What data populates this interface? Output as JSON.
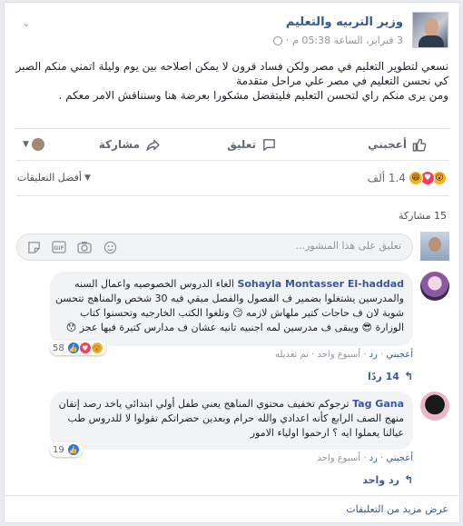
{
  "post": {
    "author": "وزير التربيه والتعليم",
    "timestamp": "3 فبراير، الساعة 05:38 م",
    "separator": "·",
    "privacy_icon": "globe-icon",
    "lines": [
      "نسعي لتطوير التعليم في مصر ولكن فساد قرون لا يمكن اصلاحه بين يوم وليلة اتمني منكم الصبر",
      "كي نحسن التعليم في مصر علي مراحل متقدمة",
      "ومن يرى منكم راي لتحسن التعليم فليتفضل مشكورا بعرضة هنا وسنناقش الامر معكم ."
    ]
  },
  "actions": {
    "like": "أعجبني",
    "comment": "تعليق",
    "share": "مشاركة"
  },
  "reactions": {
    "count": "1.4 ألف",
    "types": [
      "haha",
      "love",
      "wow"
    ]
  },
  "sort_label": "أفضل التعليقات",
  "shares": "15 مشاركة",
  "composer": {
    "placeholder": "تعليق على هذا المنشور..."
  },
  "comments": [
    {
      "author": "Sohayla Montasser El-haddad",
      "lines": [
        "الغاء الدروس الخصوصيه واعمال السنه",
        "والمدرسين يشتغلوا بضمير ف الفصول والفصل ميقي فيه 30 شخص والمناهج تتحسن",
        "شوية لان ف حاجات كتير ملهاش لازمه 😏 وتلغوا الكتب الخارجيه وتحسنوا كتاب",
        "الوزارة 😎 ويبقى ف مدرسين لمه اجنبيه تانيه عشان ف مدارس كتيرة فيها عجز 😯"
      ],
      "reactions_count": "58",
      "like": "أعجبني",
      "reply": "رد",
      "age": "أسبوع واحد",
      "edited": "تم تعديله",
      "replies": "14 ردًا"
    },
    {
      "author": "Tag Gana",
      "lines": [
        "ترجوكم تخفيف محتوي المناهج يعني طفل أولي ابتدائي ياخد رصد إتقان",
        "منهج الصف الرابع كأنه اعدادي والله حرام وبعدين حضراتكم تقولوا لا للدروس طب",
        "عيالنا يعملوا ايه ؟ ارحموا اولياء الامور"
      ],
      "reactions_count": "19",
      "like": "أعجبني",
      "reply": "رد",
      "age": "أسبوع واحد",
      "replies": "رد واحد"
    }
  ],
  "more_comments": "عرض مزيد من التعليقات",
  "colors": {
    "link": "#385898",
    "background": "#e9ebee",
    "bubble": "#f2f3f5"
  }
}
